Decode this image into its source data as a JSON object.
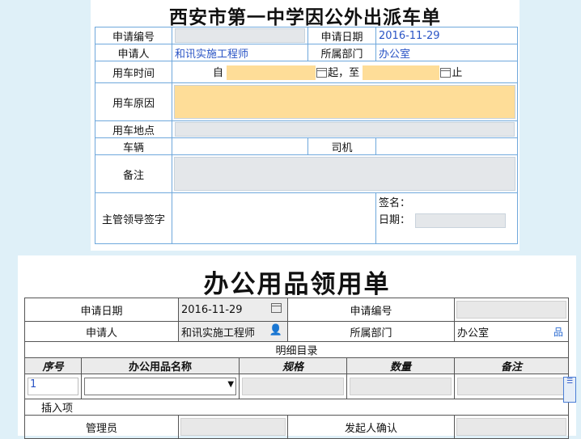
{
  "car_form": {
    "title": "西安市第一中学因公外出派车单",
    "labels": {
      "app_no": "申请编号",
      "app_date": "申请日期",
      "applicant": "申请人",
      "department": "所属部门",
      "car_time": "用车时间",
      "from": "自",
      "to": "起，至",
      "end": "止",
      "reason": "用车原因",
      "location": "用车地点",
      "vehicle": "车辆",
      "driver": "司机",
      "remark": "备注",
      "leader_sign": "主管领导签字",
      "sign": "签名：",
      "date": "日期："
    },
    "values": {
      "app_no": "",
      "app_date": "2016-11-29",
      "applicant": "和讯实施工程师",
      "department": "办公室"
    }
  },
  "office_form": {
    "title": "办公用品领用单",
    "labels": {
      "app_date": "申请日期",
      "app_no": "申请编号",
      "applicant": "申请人",
      "department": "所属部门",
      "detail": "明细目录",
      "insert_row": "插入项",
      "manager": "管理员",
      "initiator_confirm": "发起人确认"
    },
    "values": {
      "app_date": "2016-11-29",
      "applicant": "和讯实施工程师",
      "department": "办公室"
    },
    "columns": [
      "序号",
      "办公用品名称",
      "规格",
      "数量",
      "备注"
    ],
    "rows": [
      {
        "index": "1"
      }
    ]
  },
  "icons": [
    "calendar-icon",
    "user-icon",
    "org-tree-icon",
    "dropdown-arrow-icon"
  ],
  "colors": {
    "background": "#dff0f8",
    "highlight": "#fedd98",
    "link_blue": "#2a54c5",
    "border_blue": "#6fa8dc"
  }
}
